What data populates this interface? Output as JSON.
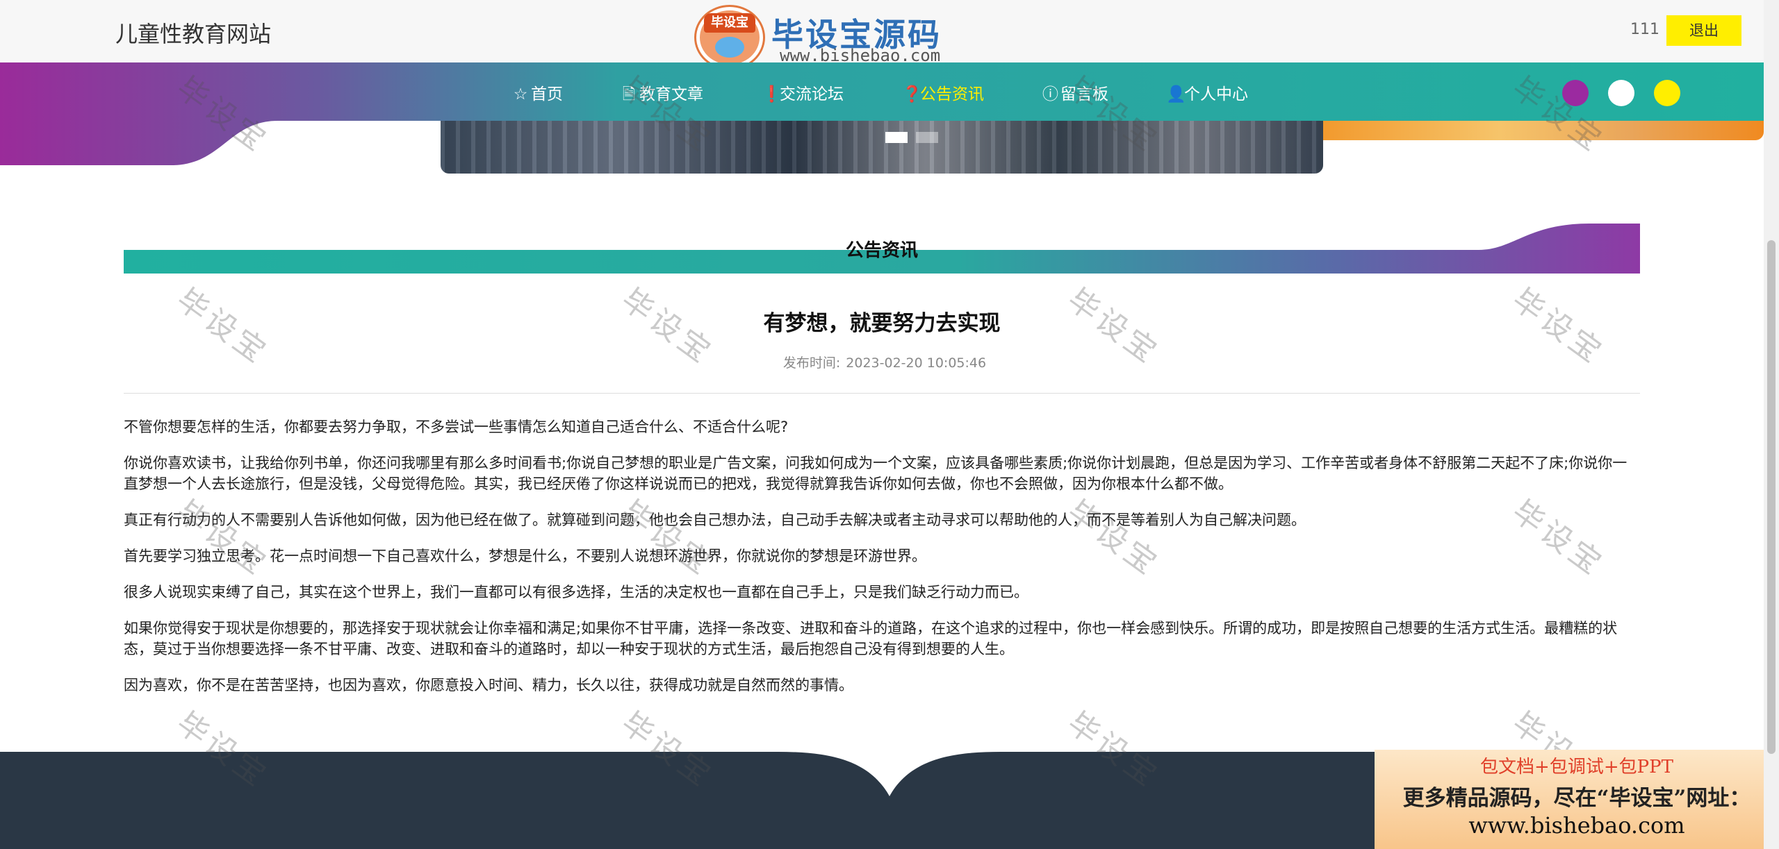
{
  "site": {
    "title": "儿童性教育网站"
  },
  "logo": {
    "badge": "毕设宝",
    "title": "毕设宝源码网",
    "url": "www.bishebao.com"
  },
  "user": {
    "name": "111",
    "logout_label": "退出"
  },
  "nav": {
    "items": [
      {
        "label": "首页",
        "icon": "star-icon",
        "glyph": "☆"
      },
      {
        "label": "教育文章",
        "icon": "document-icon",
        "glyph": "🗎"
      },
      {
        "label": "交流论坛",
        "icon": "info-icon",
        "glyph": "❗"
      },
      {
        "label": "公告资讯",
        "icon": "question-icon",
        "glyph": "❓"
      },
      {
        "label": "留言板",
        "icon": "info-circle-icon",
        "glyph": "ⓘ"
      },
      {
        "label": "个人中心",
        "icon": "user-icon",
        "glyph": "👤"
      }
    ],
    "active_index": 3
  },
  "theme": {
    "colors": [
      "#9b2aa0",
      "#ffffff",
      "#ffee00"
    ],
    "accent_teal": "#21b0a0",
    "accent_purple": "#8e3aa5",
    "active_nav": "#ffee00"
  },
  "section": {
    "title": "公告资讯"
  },
  "article": {
    "title": "有梦想，就要努力去实现",
    "date_label": "发布时间:",
    "date": "2023-02-20 10:05:46",
    "paragraphs": [
      "不管你想要怎样的生活，你都要去努力争取，不多尝试一些事情怎么知道自己适合什么、不适合什么呢?",
      "你说你喜欢读书，让我给你列书单，你还问我哪里有那么多时间看书;你说自己梦想的职业是广告文案，问我如何成为一个文案，应该具备哪些素质;你说你计划晨跑，但总是因为学习、工作辛苦或者身体不舒服第二天起不了床;你说你一直梦想一个人去长途旅行，但是没钱，父母觉得危险。其实，我已经厌倦了你这样说说而已的把戏，我觉得就算我告诉你如何去做，你也不会照做，因为你根本什么都不做。",
      "真正有行动力的人不需要别人告诉他如何做，因为他已经在做了。就算碰到问题，他也会自己想办法，自己动手去解决或者主动寻求可以帮助他的人，而不是等着别人为自己解决问题。",
      "首先要学习独立思考。花一点时间想一下自己喜欢什么，梦想是什么，不要别人说想环游世界，你就说你的梦想是环游世界。",
      "很多人说现实束缚了自己，其实在这个世界上，我们一直都可以有很多选择，生活的决定权也一直都在自己手上，只是我们缺乏行动力而已。",
      "如果你觉得安于现状是你想要的，那选择安于现状就会让你幸福和满足;如果你不甘平庸，选择一条改变、进取和奋斗的道路，在这个追求的过程中，你也一样会感到快乐。所谓的成功，即是按照自己想要的生活方式生活。最糟糕的状态，莫过于当你想要选择一条不甘平庸、改变、进取和奋斗的道路时，却以一种安于现状的方式生活，最后抱怨自己没有得到想要的人生。",
      "因为喜欢，你不是在苦苦坚持，也因为喜欢，你愿意投入时间、精力，长久以往，获得成功就是自然而然的事情。"
    ]
  },
  "watermark": {
    "text": "毕设宝"
  },
  "ad": {
    "line1": "包文档+包调试+包PPT",
    "line2": "更多精品源码，尽在“毕设宝”网址：",
    "line3": "www.bishebao.com"
  }
}
